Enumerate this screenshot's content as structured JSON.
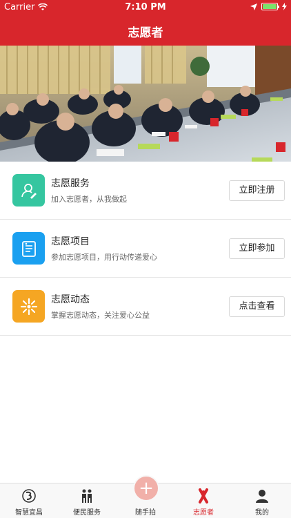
{
  "status_bar": {
    "carrier": "Carrier",
    "time": "7:10 PM"
  },
  "nav": {
    "title": "志愿者"
  },
  "banner": {
    "description_icon": "meeting-photo"
  },
  "rows": [
    {
      "title": "志愿服务",
      "subtitle": "加入志愿者，从我做起",
      "button": "立即注册",
      "icon": "volunteer-person-icon",
      "color": "#35c6a0"
    },
    {
      "title": "志愿项目",
      "subtitle": "参加志愿项目，用行动传递爱心",
      "button": "立即参加",
      "icon": "document-list-icon",
      "color": "#1aa0f0"
    },
    {
      "title": "志愿动态",
      "subtitle": "掌握志愿动态，关注爱心公益",
      "button": "点击查看",
      "icon": "sunburst-icon",
      "color": "#f5a623"
    }
  ],
  "tabs": [
    {
      "label": "智慧宜昌",
      "icon": "city-logo-icon"
    },
    {
      "label": "便民服务",
      "icon": "people-icon"
    },
    {
      "label": "随手拍",
      "icon": "plus-icon"
    },
    {
      "label": "志愿者",
      "icon": "volunteer-ribbon-icon",
      "active": true
    },
    {
      "label": "我的",
      "icon": "user-icon"
    }
  ],
  "colors": {
    "brand_red": "#d8262c",
    "tab_bg": "#f8f8f8",
    "center_button": "#f1b0a9"
  }
}
